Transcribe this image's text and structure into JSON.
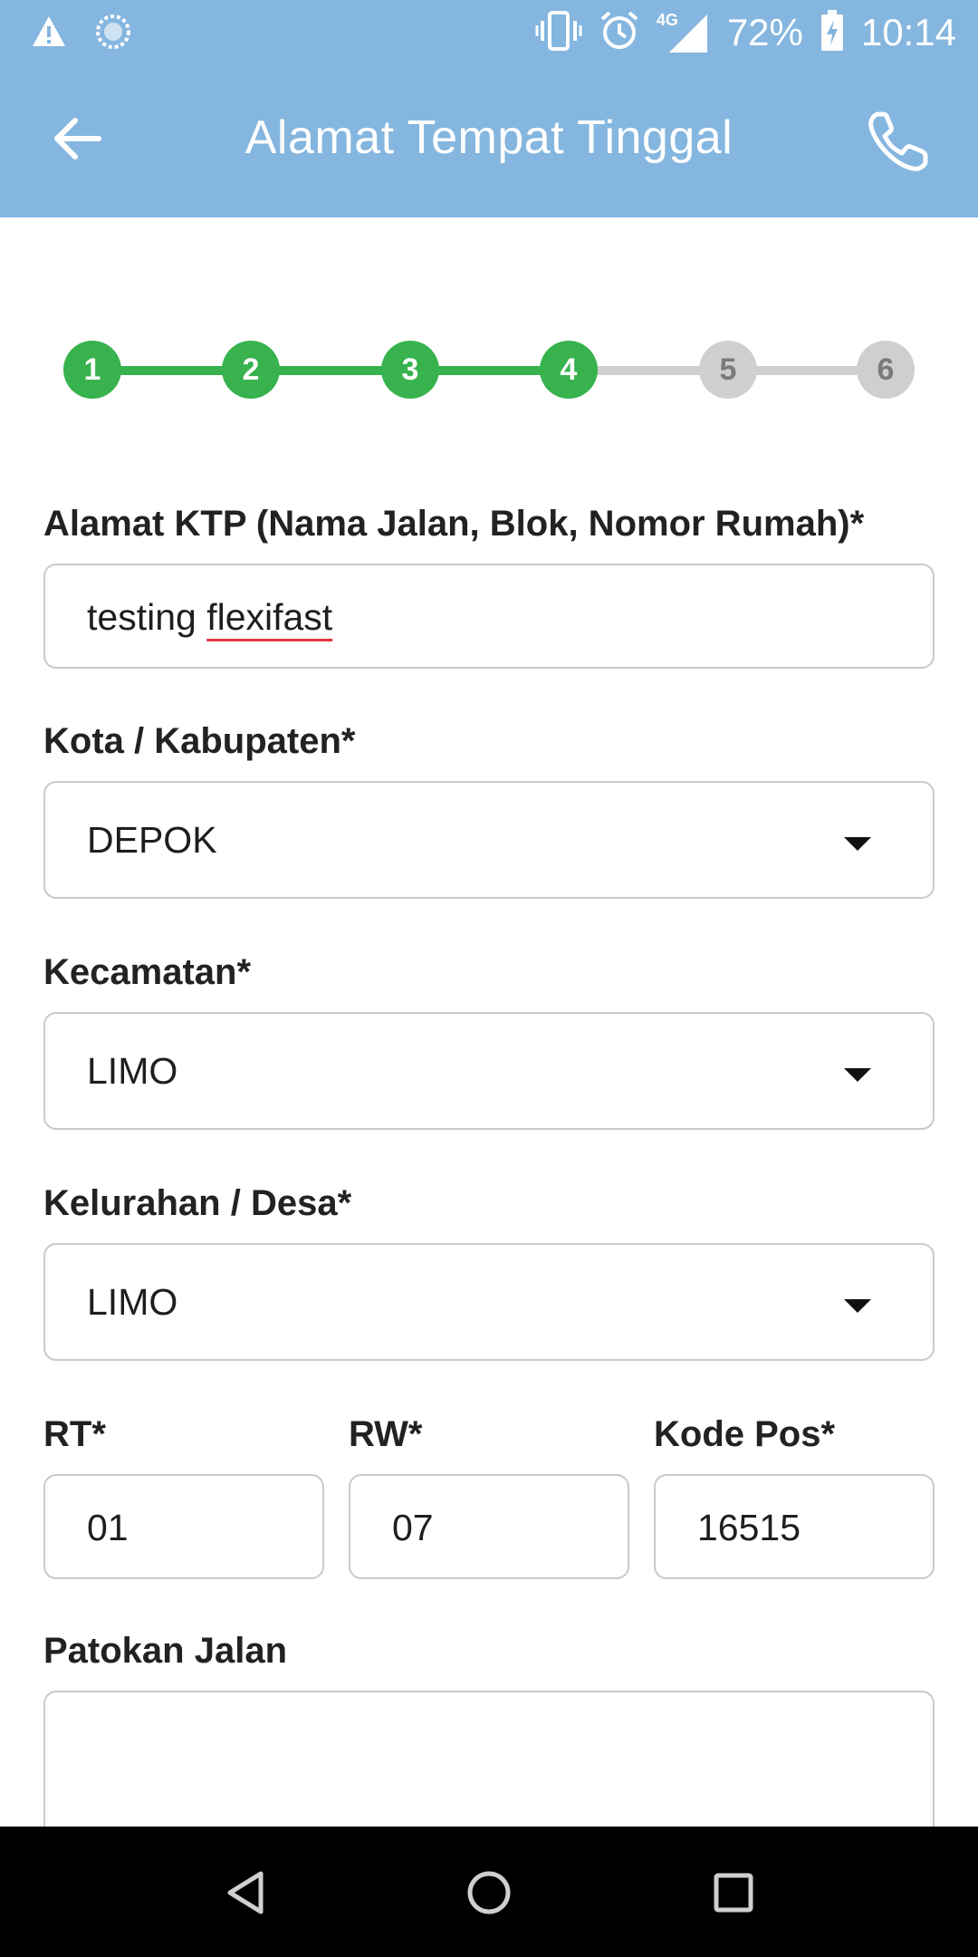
{
  "status_bar": {
    "battery": "72%",
    "time": "10:14",
    "network": "4G",
    "icons": [
      "warning-icon",
      "sync-icon",
      "vibrate-icon",
      "alarm-icon",
      "signal-icon",
      "battery-charging-icon"
    ]
  },
  "appbar": {
    "title": "Alamat Tempat Tinggal",
    "back_icon": "arrow-left-icon",
    "call_icon": "phone-icon",
    "color": "#84b6df"
  },
  "stepper": {
    "steps": [
      "1",
      "2",
      "3",
      "4",
      "5",
      "6"
    ],
    "current": 4,
    "done_color": "#37b24d",
    "todo_color": "#cfcfcf"
  },
  "form": {
    "address": {
      "label": "Alamat KTP (Nama Jalan, Blok, Nomor Rumah)*",
      "value_part1": "testing ",
      "value_part2": "flexifast"
    },
    "city": {
      "label": "Kota / Kabupaten*",
      "value": "DEPOK"
    },
    "district": {
      "label": "Kecamatan*",
      "value": "LIMO"
    },
    "village": {
      "label": "Kelurahan / Desa*",
      "value": "LIMO"
    },
    "rt": {
      "label": "RT*",
      "value": "01"
    },
    "rw": {
      "label": "RW*",
      "value": "07"
    },
    "postal": {
      "label": "Kode Pos*",
      "value": "16515"
    },
    "landmark": {
      "label": "Patokan Jalan",
      "value": ""
    }
  },
  "nav": {
    "icons": [
      "back-triangle-icon",
      "home-circle-icon",
      "recents-square-icon"
    ]
  }
}
